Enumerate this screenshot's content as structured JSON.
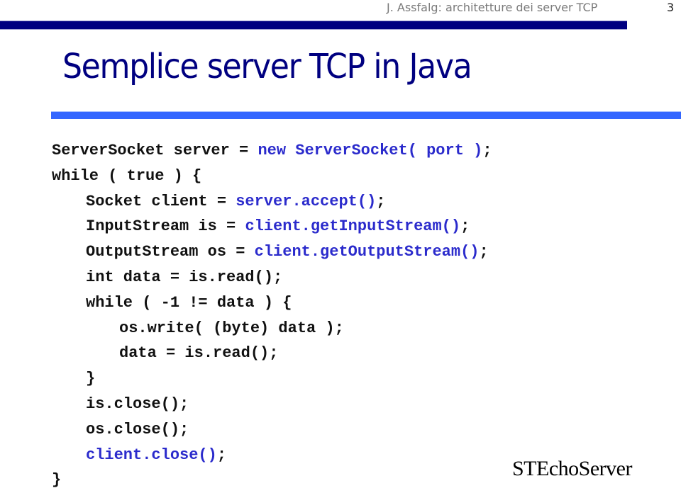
{
  "header": {
    "running_title": "J. Assfalg: architetture dei server TCP",
    "page_number": "3"
  },
  "slide": {
    "title": "Semplice server TCP in Java",
    "caption": "STEchoServer"
  },
  "colors": {
    "title": "#000080",
    "top_bar": "#000080",
    "accent_bar": "#3366ff",
    "code_default": "#111111",
    "code_highlight": "#2b2bcc"
  },
  "code": {
    "lines": [
      {
        "indent": 0,
        "segments": [
          {
            "text": "ServerSocket server = ",
            "highlight": false
          },
          {
            "text": "new ServerSocket( port )",
            "highlight": true
          },
          {
            "text": ";",
            "highlight": false
          }
        ]
      },
      {
        "indent": 0,
        "segments": [
          {
            "text": "while ( true ) {",
            "highlight": false
          }
        ]
      },
      {
        "indent": 1,
        "segments": [
          {
            "text": "Socket client = ",
            "highlight": false
          },
          {
            "text": "server.accept()",
            "highlight": true
          },
          {
            "text": ";",
            "highlight": false
          }
        ]
      },
      {
        "indent": 1,
        "segments": [
          {
            "text": "InputStream is = ",
            "highlight": false
          },
          {
            "text": "client.getInputStream()",
            "highlight": true
          },
          {
            "text": ";",
            "highlight": false
          }
        ]
      },
      {
        "indent": 1,
        "segments": [
          {
            "text": "OutputStream os = ",
            "highlight": false
          },
          {
            "text": "client.getOutputStream()",
            "highlight": true
          },
          {
            "text": ";",
            "highlight": false
          }
        ]
      },
      {
        "indent": 1,
        "segments": [
          {
            "text": "int data = is.read();",
            "highlight": false
          }
        ]
      },
      {
        "indent": 1,
        "segments": [
          {
            "text": "while ( -1 != data ) {",
            "highlight": false
          }
        ]
      },
      {
        "indent": 2,
        "segments": [
          {
            "text": "os.write( (byte) data );",
            "highlight": false
          }
        ]
      },
      {
        "indent": 2,
        "segments": [
          {
            "text": "data = is.read();",
            "highlight": false
          }
        ]
      },
      {
        "indent": 1,
        "segments": [
          {
            "text": "}",
            "highlight": false
          }
        ]
      },
      {
        "indent": 1,
        "segments": [
          {
            "text": "is.close();",
            "highlight": false
          }
        ]
      },
      {
        "indent": 1,
        "segments": [
          {
            "text": "os.close();",
            "highlight": false
          }
        ]
      },
      {
        "indent": 1,
        "segments": [
          {
            "text": "client.close()",
            "highlight": true
          },
          {
            "text": ";",
            "highlight": false
          }
        ]
      },
      {
        "indent": 0,
        "segments": [
          {
            "text": "}",
            "highlight": false
          }
        ]
      }
    ]
  }
}
